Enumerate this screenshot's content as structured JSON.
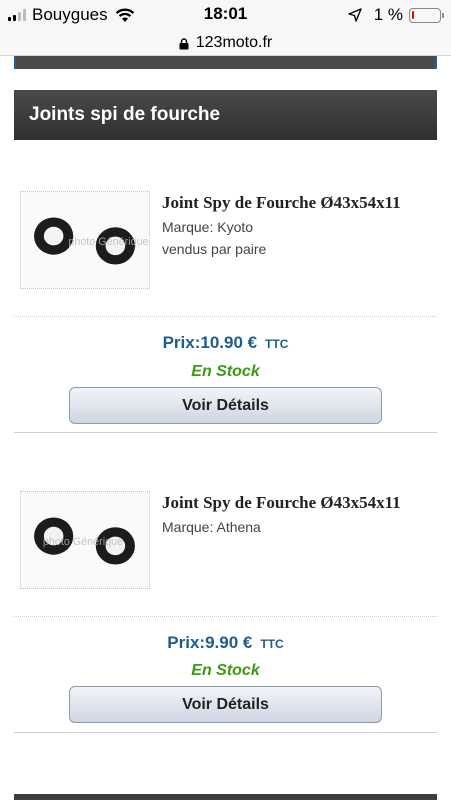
{
  "status_bar": {
    "carrier": "Bouygues",
    "time": "18:01",
    "battery_text": "1 %"
  },
  "url_bar": {
    "url": "123moto.fr"
  },
  "section": {
    "title": "Joints spi de fourche"
  },
  "products": [
    {
      "title": "Joint Spy de Fourche Ø43x54x11",
      "brand": "Marque: Kyoto",
      "note": "vendus par paire",
      "price": "Prix:10.90 €",
      "ttc": "TTC",
      "stock": "En Stock",
      "button": "Voir Détails"
    },
    {
      "title": "Joint Spy de Fourche Ø43x54x11",
      "brand": "Marque: Athena",
      "note": "",
      "price": "Prix:9.90 €",
      "ttc": "TTC",
      "stock": "En Stock",
      "button": "Voir Détails"
    }
  ],
  "colors": {
    "price": "#1b5e8c",
    "stock": "#3a9a12",
    "header_bg": "#3a3a3a"
  }
}
